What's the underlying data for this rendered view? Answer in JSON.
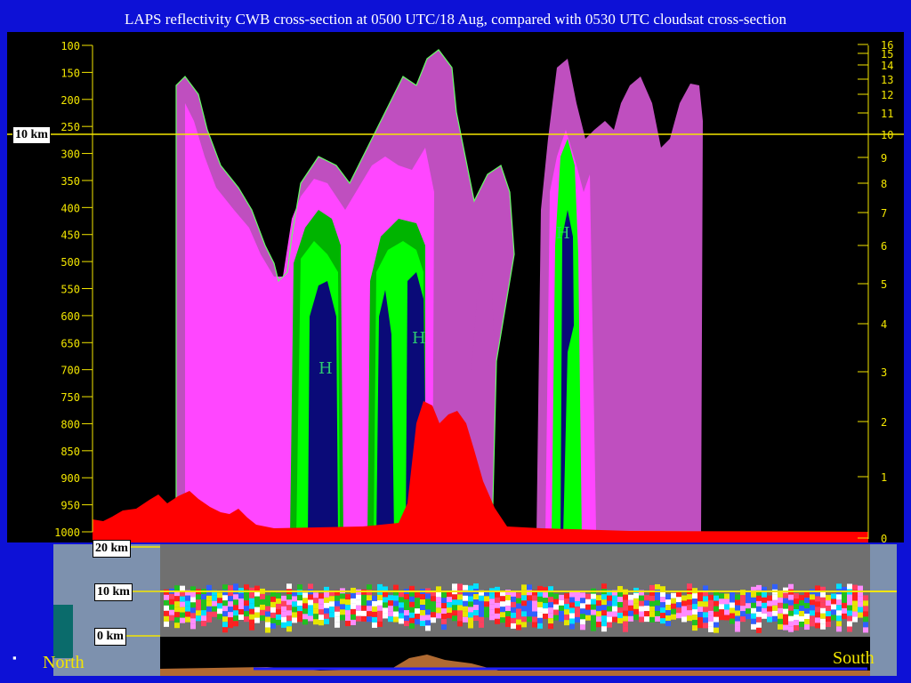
{
  "page": {
    "title": "LAPS reflectivity CWB cross-section at 0500 UTC/18 Aug, compared with 0530 UTC cloudsat cross-section",
    "bullet": "▪"
  },
  "colors": {
    "background": "#0d11d6",
    "plot_bg": "#000000",
    "axis": "#f3e600",
    "terrain": "#ff0000",
    "refl_light": "#bf4fbf",
    "refl_magenta": "#ff46ff",
    "refl_green": "#00ff00",
    "refl_darkgreen": "#00b400",
    "refl_navy": "#0a0a78",
    "contour": "#66ff66",
    "reference_line": "#f3e600"
  },
  "labels": {
    "ten_km_main": "10 km",
    "cs_20km": "20 km",
    "cs_10km": "10 km",
    "cs_0km": "0 km",
    "north": "North",
    "south": "South"
  },
  "chart_data": [
    {
      "type": "area",
      "title": "LAPS reflectivity CWB cross-section at 0500 UTC/18 Aug",
      "left_axis": {
        "ticks": [
          "100",
          "150",
          "200",
          "250",
          "300",
          "350",
          "400",
          "450",
          "500",
          "550",
          "600",
          "650",
          "700",
          "750",
          "800",
          "850",
          "900",
          "950",
          "1000"
        ]
      },
      "right_axis": {
        "ticks": [
          "16",
          "15",
          "14",
          "13",
          "12",
          "11",
          "10",
          "9",
          "8",
          "7",
          "6",
          "5",
          "4",
          "3",
          "2",
          "1",
          "0"
        ]
      },
      "reference_line": {
        "label": "10 km",
        "height_km": 10
      },
      "annotations": [
        "H",
        "H",
        "H"
      ],
      "series": [
        {
          "kind": "terrain",
          "color": "#ff0000",
          "pressure_min": 755
        },
        {
          "kind": "reflectivity",
          "levels": [
            "light",
            "medium",
            "strong",
            "very strong",
            "core"
          ]
        }
      ]
    },
    {
      "type": "heatmap",
      "title": "0530 UTC cloudsat cross-section",
      "y_labels": [
        "20 km",
        "10 km",
        "0 km"
      ],
      "x_labels": [
        "North",
        "South"
      ]
    }
  ]
}
